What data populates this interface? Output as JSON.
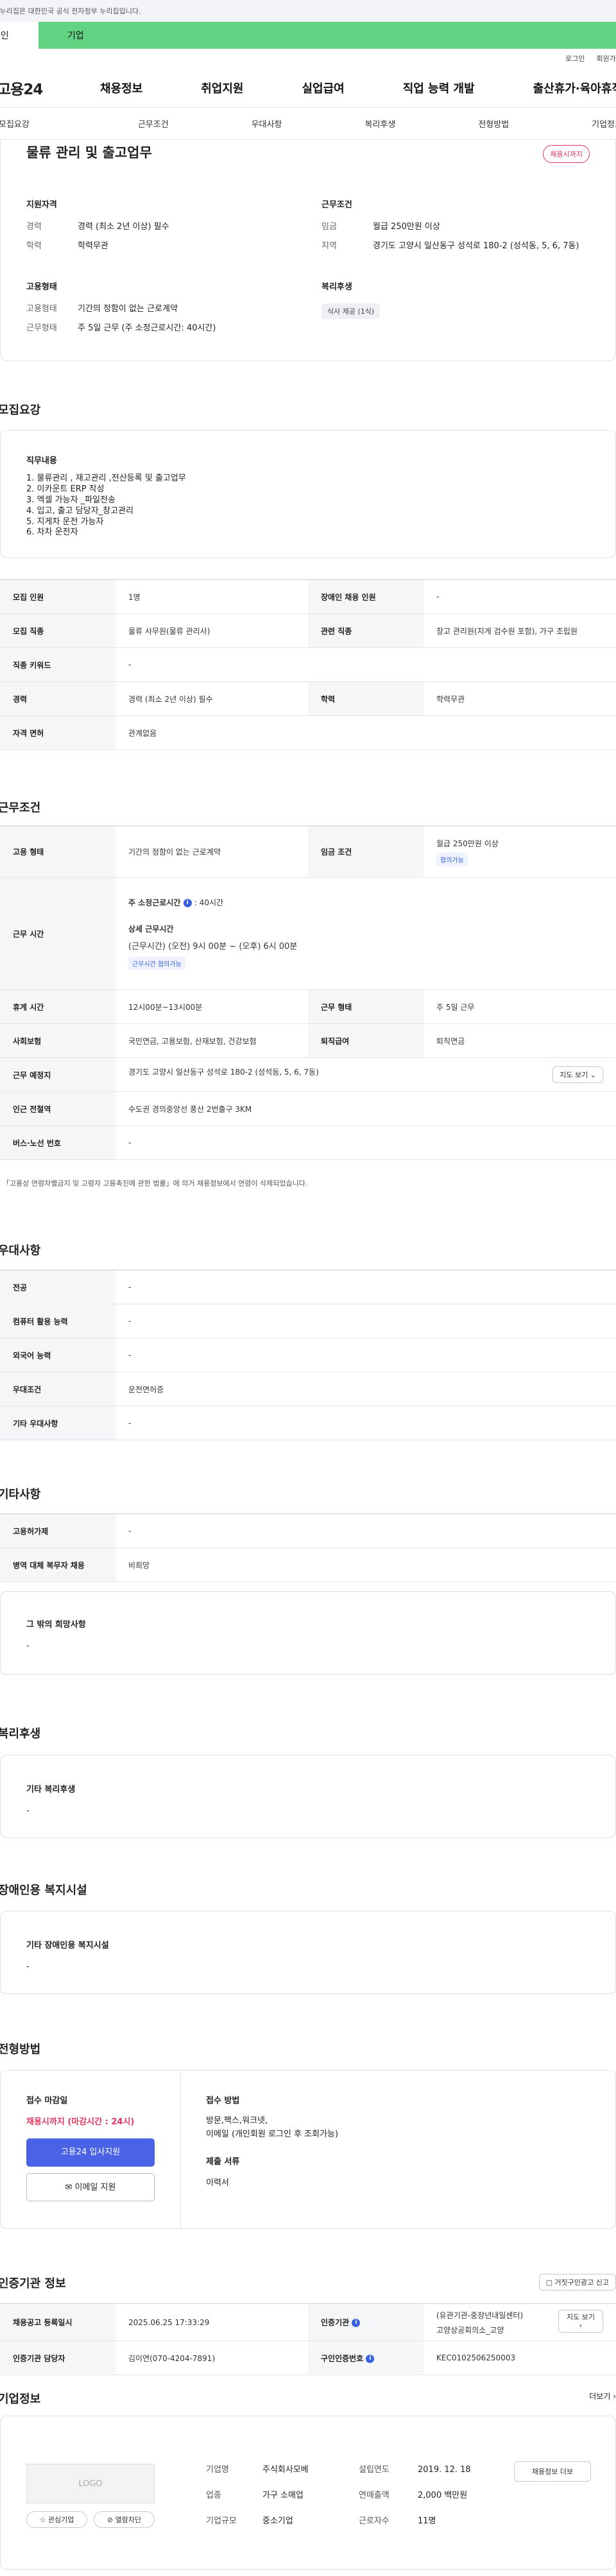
{
  "gov_banner": "이 누리집은 대한민국 공식 전자정부 누리집입니다.",
  "user_tabs": {
    "personal": "개인",
    "business": "기업"
  },
  "util_links": [
    "로그인",
    "회원가입"
  ],
  "logo": "고용24",
  "gnb": [
    "채용정보",
    "취업지원",
    "실업급여",
    "직업 능력 개발",
    "출산휴가·육아휴직"
  ],
  "anchor_tabs": [
    "모집요강",
    "근무조건",
    "우대사항",
    "복리후생",
    "전형방법",
    "기업정보"
  ],
  "summary": {
    "title": "물류 관리 및 출고업무",
    "status": "채용시까지",
    "qualification_heading": "지원자격",
    "career_label": "경력",
    "career_value": "경력 (최소 2년 이상) 필수",
    "education_label": "학력",
    "education_value": "학력무관",
    "work_heading": "근무조건",
    "wage_label": "임금",
    "wage_value": "월급 250만원 이상",
    "region_label": "지역",
    "region_value": "경기도 고양시 일산동구 성석로 180-2 (성석동, 5, 6, 7동)",
    "employment_heading": "고용형태",
    "emp_type_label": "고용형태",
    "emp_type_value": "기간의 정함이 없는 근로계약",
    "hours_label": "근무형태",
    "hours_value": "주 5일 근무 (주 소정근로시간: 40시간)",
    "welfare_heading": "복리후생",
    "welfare_chip": "식사 제공 (1식)"
  },
  "recruit": {
    "title": "모집요강",
    "job_heading": "직무내용",
    "job_lines": [
      "1. 물류관리 , 재고관리 ,전산등록 및 출고업무",
      "2. 이카운트 ERP 작성",
      "3. 엑셀 가능자 _파일전송",
      "4. 입고, 출고 담당자_창고관리",
      "5. 지게차 운전 가능자",
      "6. 차차 운전자"
    ],
    "rows": [
      {
        "h1": "모집 인원",
        "v1": "1명",
        "h2": "장애인 채용 인원",
        "v2": "-"
      },
      {
        "h1": "모집 직종",
        "v1": "물류 사무원(물류 관리사)",
        "h2": "관련 직종",
        "v2": "창고 관리원(지게 검수원 포함), 가구 조립원"
      },
      {
        "h1": "직종 키워드",
        "v1": "-"
      },
      {
        "h1": "경력",
        "v1": "경력 (최소 2년 이상) 필수",
        "h2": "학력",
        "v2": "학력무관"
      },
      {
        "h1": "자격 면허",
        "v1": "관계없음"
      }
    ]
  },
  "conditions": {
    "title": "근무조건",
    "emp_type_h": "고용 형태",
    "emp_type_v": "기간의 정함이 없는 근로계약",
    "wage_h": "임금 조건",
    "wage_v": "월급 250만원 이상",
    "wage_badge": "협의가능",
    "worktime_h": "근무 시간",
    "weekly_label": "주 소정근로시간",
    "weekly_value": ": 40시간",
    "detail_label": "상세 근무시간",
    "detail_value": "(근무시간) (오전) 9시 00분 ~ (오후) 6시 00분",
    "detail_badge": "근무시간 협의가능",
    "break_h": "휴게 시간",
    "break_v": "12시00분~13시00분",
    "shift_h": "근무 형태",
    "shift_v": "주 5일 근무",
    "insurance_h": "사회보험",
    "insurance_v": "국민연금, 고용보험, 산재보험, 건강보험",
    "severance_h": "퇴직급여",
    "severance_v": "퇴직연금",
    "location_h": "근무 예정지",
    "location_v": "경기도 고양시 일산동구 성석로 180-2 (성석동, 5, 6, 7동)",
    "map_btn": "지도 보기",
    "subway_h": "인근 전철역",
    "subway_v": "수도권 경의중앙선 풍산 2번출구 3KM",
    "bus_h": "버스·노선 번호",
    "bus_v": "-",
    "footnote": "「고용상 연령차별금지 및 고령자 고용촉진에 관한 법률」에 의거 채용정보에서 연령이 삭제되었습니다."
  },
  "preference": {
    "title": "우대사항",
    "rows": [
      {
        "h": "전공",
        "v": "-"
      },
      {
        "h": "컴퓨터 활용 능력",
        "v": "-"
      },
      {
        "h": "외국어 능력",
        "v": "-"
      },
      {
        "h": "우대조건",
        "v": "운전면허증"
      },
      {
        "h": "기타 우대사항",
        "v": "-"
      }
    ]
  },
  "etc": {
    "title": "기타사항",
    "rows": [
      {
        "h": "고용허가제",
        "v": "-"
      },
      {
        "h": "병역 대체 복무자 채용",
        "v": "비희망"
      }
    ],
    "wish_heading": "그 밖의 희망사항",
    "wish_value": "-"
  },
  "welfare": {
    "title": "복리후생",
    "heading": "기타 복리후생",
    "value": "-"
  },
  "disabled": {
    "title": "장애인용 복지시설",
    "heading": "기타 장애인용 복지시설",
    "value": "-"
  },
  "screening": {
    "title": "전형방법",
    "deadline_heading": "접수 마감일",
    "deadline_value": "채용시까지 (마감시간 : 24시)",
    "apply_button": "고용24 입사지원",
    "email_button": "이메일 지원",
    "method_heading": "접수 방법",
    "method_value1": "방문,팩스,워크넷,",
    "method_value2": "이메일 (개인회원 로그인 후 조회가능)",
    "docs_heading": "제출 서류",
    "docs_value": "이력서"
  },
  "cert": {
    "title": "인증기관 정보",
    "report_button": "거짓구인광고 신고",
    "reg_date_h": "채용공고 등록일시",
    "reg_date_v": "2025.06.25 17:33:29",
    "agency_h": "인증기관",
    "agency_v1": "(유관기관-중장년내일센터)",
    "agency_v2": "고양상공회의소_고양",
    "map_btn": "지도 보기",
    "manager_h": "인증기관 담당자",
    "manager_v": "김이연(070-4204-7891)",
    "cert_no_h": "구인인증번호",
    "cert_no_v": "KEC0102506250003"
  },
  "company": {
    "title": "기업정보",
    "more": "더보기",
    "logo_text": "LOGO",
    "name_label": "기업명",
    "name_value": "주식회사모베",
    "industry_label": "업종",
    "industry_value": "가구 소매업",
    "size_label": "기업규모",
    "size_value": "중소기업",
    "founded_label": "설립연도",
    "founded_value": "2019. 12. 18",
    "sales_label": "연매출액",
    "sales_value": "2,000 백만원",
    "employees_label": "근로자수",
    "employees_value": "11명",
    "recruit_btn": "채용정보 더보",
    "fav_btn": "관심기업",
    "block_btn": "열람차단"
  }
}
